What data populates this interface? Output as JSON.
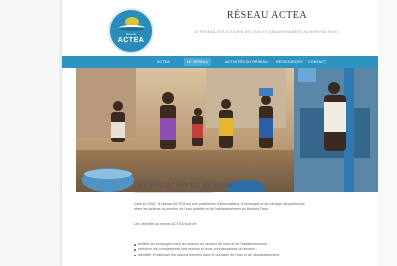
{
  "site": {
    "logo_small_text": "Réseau",
    "logo_text": "ACTEA",
    "title": "RÉSEAU ACTEA",
    "tagline": "LE RÉSEAU DES ACTEURS DE L'EAU ET ASSAINISSEMENT AU BURKINA FASO"
  },
  "nav": {
    "items": [
      {
        "label": "ACTEA"
      },
      {
        "label": "LE RÉSEAU"
      },
      {
        "label": "ACTIVITÉS DU RÉSEAU"
      },
      {
        "label": "RESSOURCES"
      },
      {
        "label": "CONTACT"
      }
    ],
    "active_index": 1
  },
  "main": {
    "section_title": "PRÉSENTATION DU RÉSEAU",
    "paragraph1": "Créé en 2002, le réseau ACTEA est une plateforme d'informations, d'échanges et de partage d'expériences entre les acteurs du secteur de l'eau potable et de l'assainissement au Burkina Faso.",
    "paragraph2": "Les objectifs du réseau ACTEA sont de :",
    "bullets": [
      "faciliter les échanges entre les acteurs du secteur de l'eau et de l'assainissement ;",
      "renforcer les compétences des acteurs et leurs connaissances du secteur ;",
      "identifier et valoriser les actions menées dans le domaine de l'eau et de l'assainissement."
    ]
  },
  "colors": {
    "nav_bg": "#2d93c1",
    "logo_bg": "#2a8cba",
    "accent": "#4aa7d1"
  }
}
